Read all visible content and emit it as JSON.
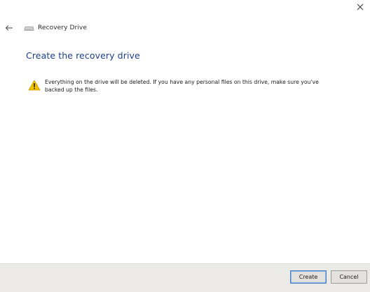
{
  "window": {
    "title": "Recovery Drive",
    "close_label": "×",
    "back_label": "←"
  },
  "main": {
    "heading": "Create the recovery drive",
    "warning": "Everything on the drive will be deleted. If you have any personal files on this drive, make sure you've backed up the files."
  },
  "footer": {
    "create_label": "Create",
    "cancel_label": "Cancel"
  },
  "icons": {
    "title": "drive-icon",
    "warning": "warning-icon",
    "back": "back-arrow-icon",
    "close": "close-icon"
  },
  "colors": {
    "heading": "#1d3e8a",
    "warning_yellow": "#f2c200",
    "footer_bg": "#eceae6",
    "primary_button_border": "#4a7fc8"
  }
}
